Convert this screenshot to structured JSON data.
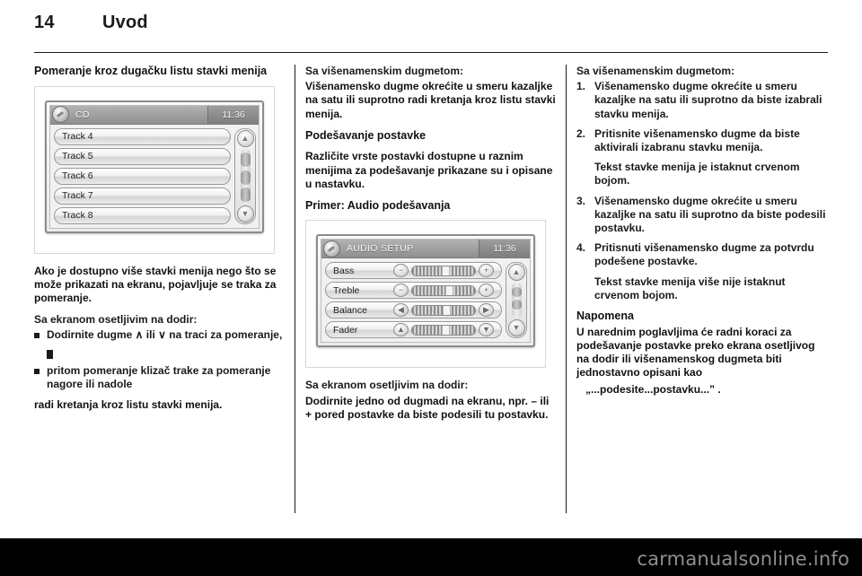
{
  "header": {
    "page_number": "14",
    "chapter": "Uvod"
  },
  "left_column": {
    "title": "Pomeranje kroz dugačku listu stavki menija",
    "figure": {
      "title": "CD",
      "clock": "11:36",
      "icon": "cd-disc-icon",
      "rows": [
        "Track 4",
        "Track 5",
        "Track 6",
        "Track 7",
        "Track 8"
      ],
      "scroll_up_icon": "chevron-up-icon",
      "scroll_down_icon": "chevron-down-icon"
    },
    "paragraph_1": "Ako je dostupno više stavki menija nego što se može prikazati na ekranu, pojavljuje se traka za pomeranje.",
    "touch_lead": "Sa ekranom osetljivim na dodir:",
    "bullets": [
      "Dodirnite dugme ∧ ili ∨ na traci za pomeranje,",
      "pritom pomeranje klizač trake za pomeranje nagore ili nadole"
    ],
    "closing": "radi kretanja kroz listu stavki menija."
  },
  "middle_column": {
    "knob_lead": "Sa višenamenskim dugmetom:",
    "knob_text": "Višenamensko dugme okrećite u smeru kazaljke na satu ili suprotno radi kretanja kroz listu stavki menija.",
    "setting_title": "Podešavanje postavke",
    "setting_text": "Različite vrste postavki dostupne u raznim menijima za podešavanje prikazane su i opisane u nastavku.",
    "example_title": "Primer: Audio podešavanja",
    "figure": {
      "title": "AUDIO SETUP",
      "clock": "11:36",
      "icon": "audio-setup-icon",
      "rows": [
        {
          "label": "Bass",
          "minus_icon": "minus-icon",
          "plus_icon": "plus-icon",
          "value_pct": 50
        },
        {
          "label": "Treble",
          "minus_icon": "minus-icon",
          "plus_icon": "plus-icon",
          "value_pct": 56
        },
        {
          "label": "Balance",
          "minus_icon": "chevron-left-icon",
          "plus_icon": "chevron-right-icon",
          "value_pct": 52
        },
        {
          "label": "Fader",
          "minus_icon": "chevron-up-icon",
          "plus_icon": "chevron-down-icon",
          "value_pct": 50
        }
      ],
      "scroll_up_icon": "chevron-up-icon",
      "scroll_down_icon": "chevron-down-icon"
    },
    "touch_lead": "Sa ekranom osetljivim na dodir:",
    "touch_text": "Dodirnite jedno od dugmadi na ekranu, npr. – ili + pored postavke da biste podesili tu postavku."
  },
  "right_column": {
    "knob_lead": "Sa višenamenskim dugmetom:",
    "steps": [
      {
        "num": "1.",
        "text": "Višenamensko dugme okrećite u smeru kazaljke na satu ili suprotno da biste izabrali stavku menija."
      },
      {
        "num": "2.",
        "text": "Pritisnite višenamensko dugme da biste aktivirali izabranu stavku menija.",
        "note": "Tekst stavke menija je istaknut crvenom bojom."
      },
      {
        "num": "3.",
        "text": "Višenamensko dugme okrećite u smeru kazaljke na satu ili suprotno da biste podesili postavku."
      },
      {
        "num": "4.",
        "text": "Pritisnuti višenamensko dugme za potvrdu podešene postavke.",
        "note": "Tekst stavke menija više nije istaknut crvenom bojom."
      }
    ],
    "note_title": "Napomena",
    "note_text": "U narednim poglavljima će radni koraci za podešavanje postavke preko ekrana osetljivog na dodir ili višenamenskog dugmeta biti jednostavno opisani kao",
    "note_quote": "„...podesite...postavku...” ."
  },
  "footer": {
    "watermark": "carmanualsonline.info"
  }
}
